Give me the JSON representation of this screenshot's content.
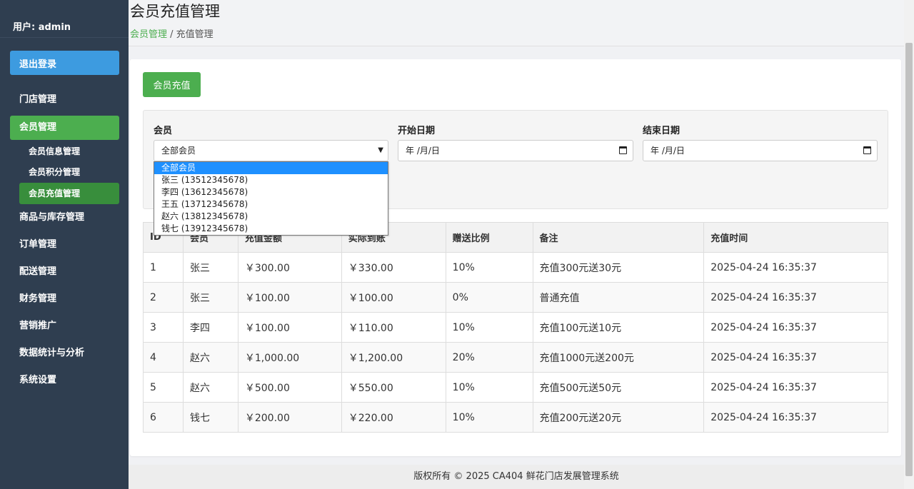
{
  "sidebar": {
    "user": "用户: admin",
    "logout": "退出登录",
    "nav": [
      {
        "label": "门店管理"
      },
      {
        "label": "会员管理",
        "sub": [
          {
            "label": "会员信息管理"
          },
          {
            "label": "会员积分管理"
          },
          {
            "label": "会员充值管理"
          }
        ]
      },
      {
        "label": "商品与库存管理"
      },
      {
        "label": "订单管理"
      },
      {
        "label": "配送管理"
      },
      {
        "label": "财务管理"
      },
      {
        "label": "营销推广"
      },
      {
        "label": "数据统计与分析"
      },
      {
        "label": "系统设置"
      }
    ]
  },
  "header": {
    "title": "会员充值管理",
    "breadcrumb_link": "会员管理",
    "breadcrumb_sep": " / ",
    "breadcrumb_current": "充值管理"
  },
  "toolbar": {
    "recharge_label": "会员充值"
  },
  "filters": {
    "member_label": "会员",
    "member_value": "全部会员",
    "start_label": "开始日期",
    "start_value": "年 /月/日",
    "end_label": "结束日期",
    "end_value": "年 /月/日",
    "options": [
      "全部会员",
      "张三 (13512345678)",
      "李四 (13612345678)",
      "王五 (13712345678)",
      "赵六 (13812345678)",
      "钱七 (13912345678)"
    ]
  },
  "table": {
    "headers": [
      "ID",
      "会员",
      "充值金额",
      "实际到账",
      "赠送比例",
      "备注",
      "充值时间"
    ],
    "rows": [
      [
        "1",
        "张三",
        "￥300.00",
        "￥330.00",
        "10%",
        "充值300元送30元",
        "2025-04-24 16:35:37"
      ],
      [
        "2",
        "张三",
        "￥100.00",
        "￥100.00",
        "0%",
        "普通充值",
        "2025-04-24 16:35:37"
      ],
      [
        "3",
        "李四",
        "￥100.00",
        "￥110.00",
        "10%",
        "充值100元送10元",
        "2025-04-24 16:35:37"
      ],
      [
        "4",
        "赵六",
        "￥1,000.00",
        "￥1,200.00",
        "20%",
        "充值1000元送200元",
        "2025-04-24 16:35:37"
      ],
      [
        "5",
        "赵六",
        "￥500.00",
        "￥550.00",
        "10%",
        "充值500元送50元",
        "2025-04-24 16:35:37"
      ],
      [
        "6",
        "钱七",
        "￥200.00",
        "￥220.00",
        "10%",
        "充值200元送20元",
        "2025-04-24 16:35:37"
      ]
    ]
  },
  "footer": {
    "text": "版权所有 © 2025 CA404 鲜花门店发展管理系统"
  },
  "colors": {
    "sidebar": "#2f3e50",
    "accent_green": "#4cae4f",
    "accent_blue": "#3d9be0"
  }
}
